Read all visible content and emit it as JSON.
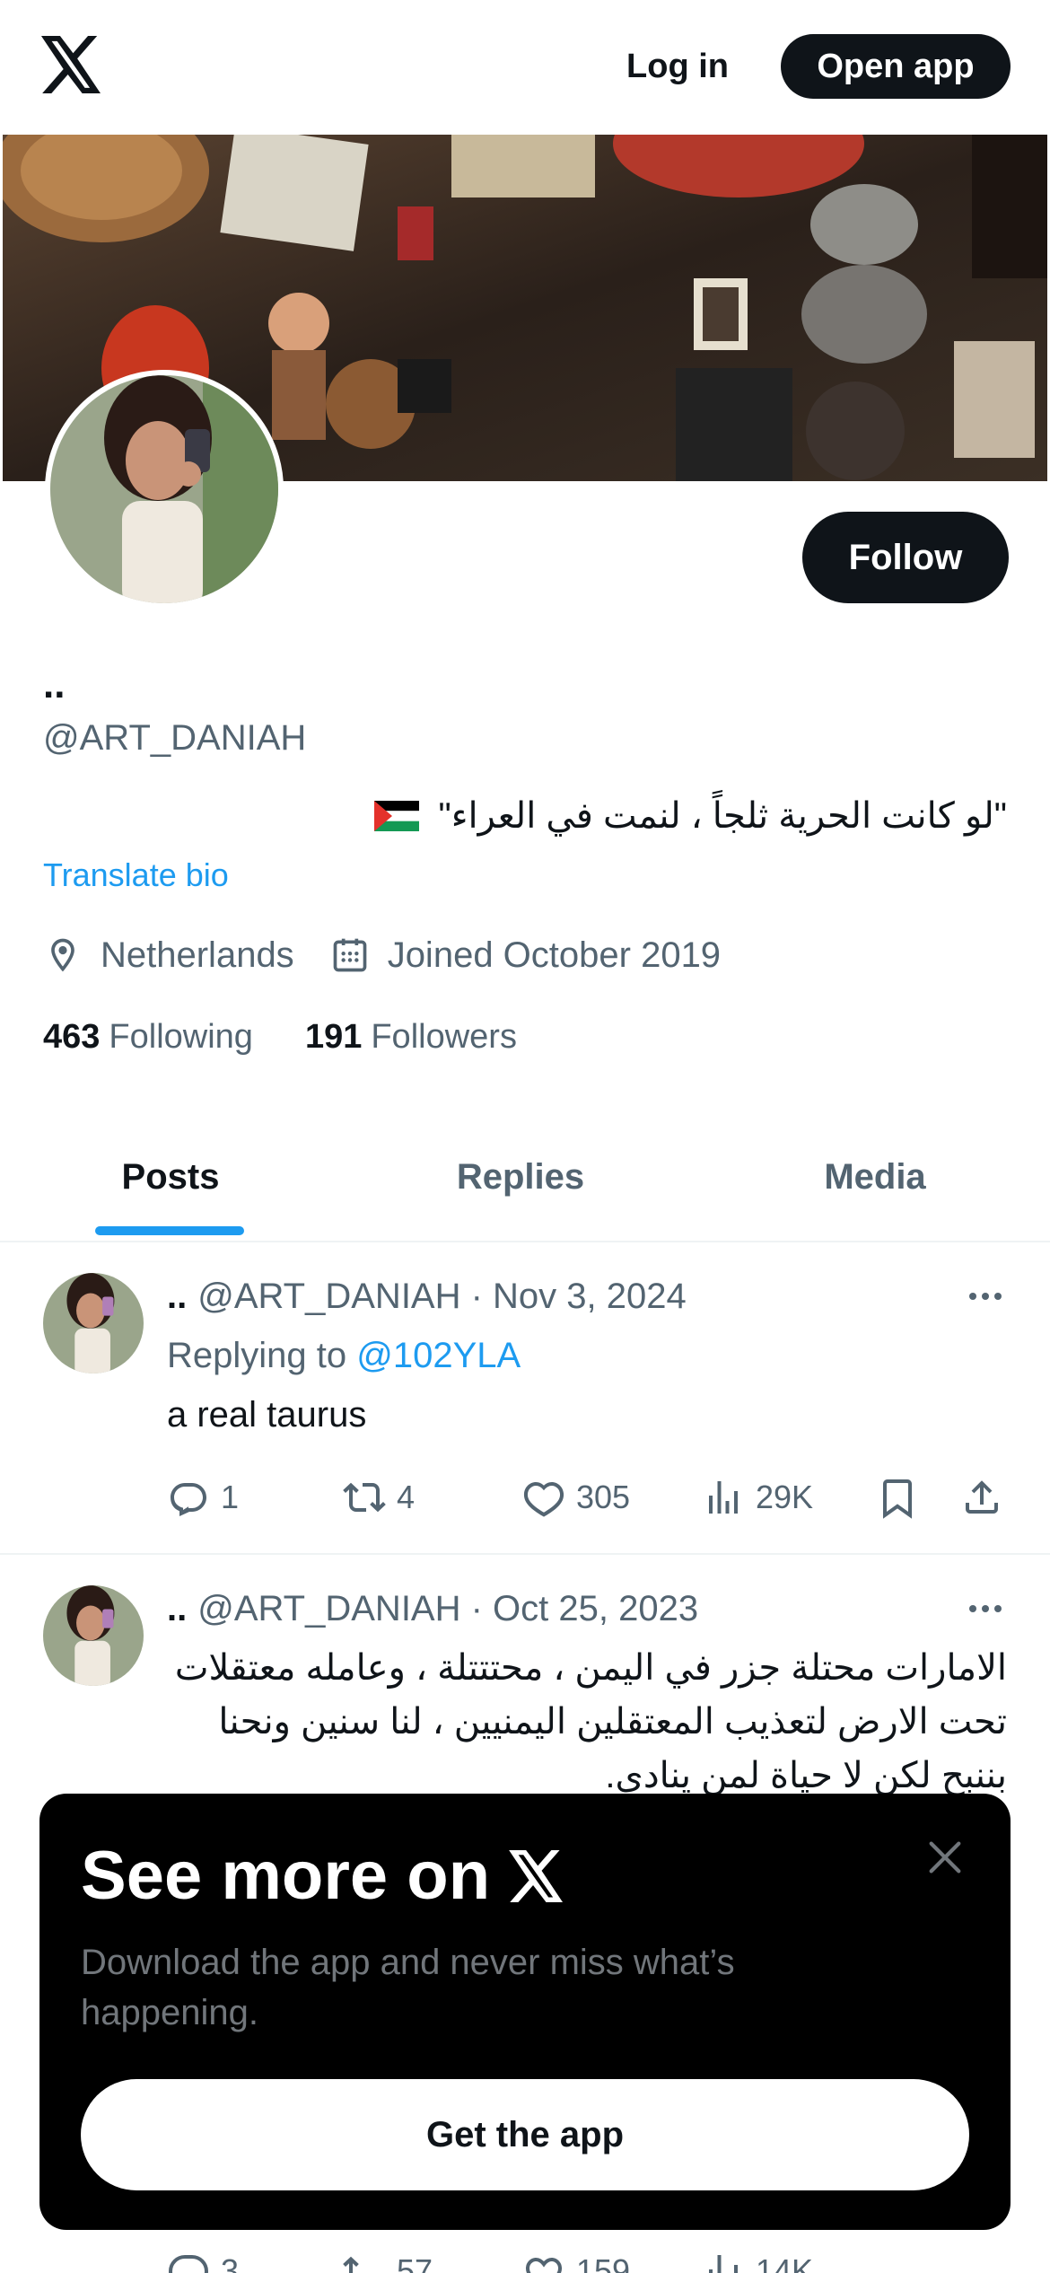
{
  "topbar": {
    "login_label": "Log in",
    "open_app_label": "Open app"
  },
  "profile": {
    "display_name": "..",
    "handle": "@ART_DANIAH",
    "bio": "\"لو كانت الحرية ثلجاً ، لنمت في العراء\"",
    "translate_label": "Translate bio",
    "location": "Netherlands",
    "joined": "Joined October 2019",
    "following_count": "463",
    "following_label": "Following",
    "followers_count": "191",
    "followers_label": "Followers",
    "follow_label": "Follow"
  },
  "tabs": [
    {
      "label": "Posts",
      "active": true
    },
    {
      "label": "Replies",
      "active": false
    },
    {
      "label": "Media",
      "active": false
    }
  ],
  "posts": [
    {
      "name": "..",
      "handle_date": "@ART_DANIAH · Nov 3, 2024",
      "replying_prefix": "Replying to ",
      "replying_to": "@102YLA",
      "text": "a real taurus",
      "replies": "1",
      "reposts": "4",
      "likes": "305",
      "views": "29K"
    },
    {
      "name": "..",
      "handle_date": "@ART_DANIAH · Oct 25, 2023",
      "text": "الامارات محتلة جزر في اليمن ، محتتتلة ، وعامله معتقلات تحت الارض لتعذيب المعتقلين اليمنيين ، لنا سنين ونحنا بننبح لكن لا حياة لمن ينادي.",
      "replies": "3",
      "reposts": "57",
      "likes": "159",
      "views": "14K"
    }
  ],
  "sheet": {
    "title": "See more on",
    "subtitle": "Download the app and never miss what’s happening.",
    "get_app_label": "Get the app"
  },
  "colors": {
    "accent": "#1d9bf0",
    "text_primary": "#0f1419",
    "text_secondary": "#536471",
    "dark_button": "#0f1419"
  },
  "icons": [
    "x-logo-icon",
    "location-pin-icon",
    "calendar-icon",
    "reply-icon",
    "repost-icon",
    "like-icon",
    "views-icon",
    "bookmark-icon",
    "share-icon",
    "more-icon",
    "close-icon"
  ]
}
